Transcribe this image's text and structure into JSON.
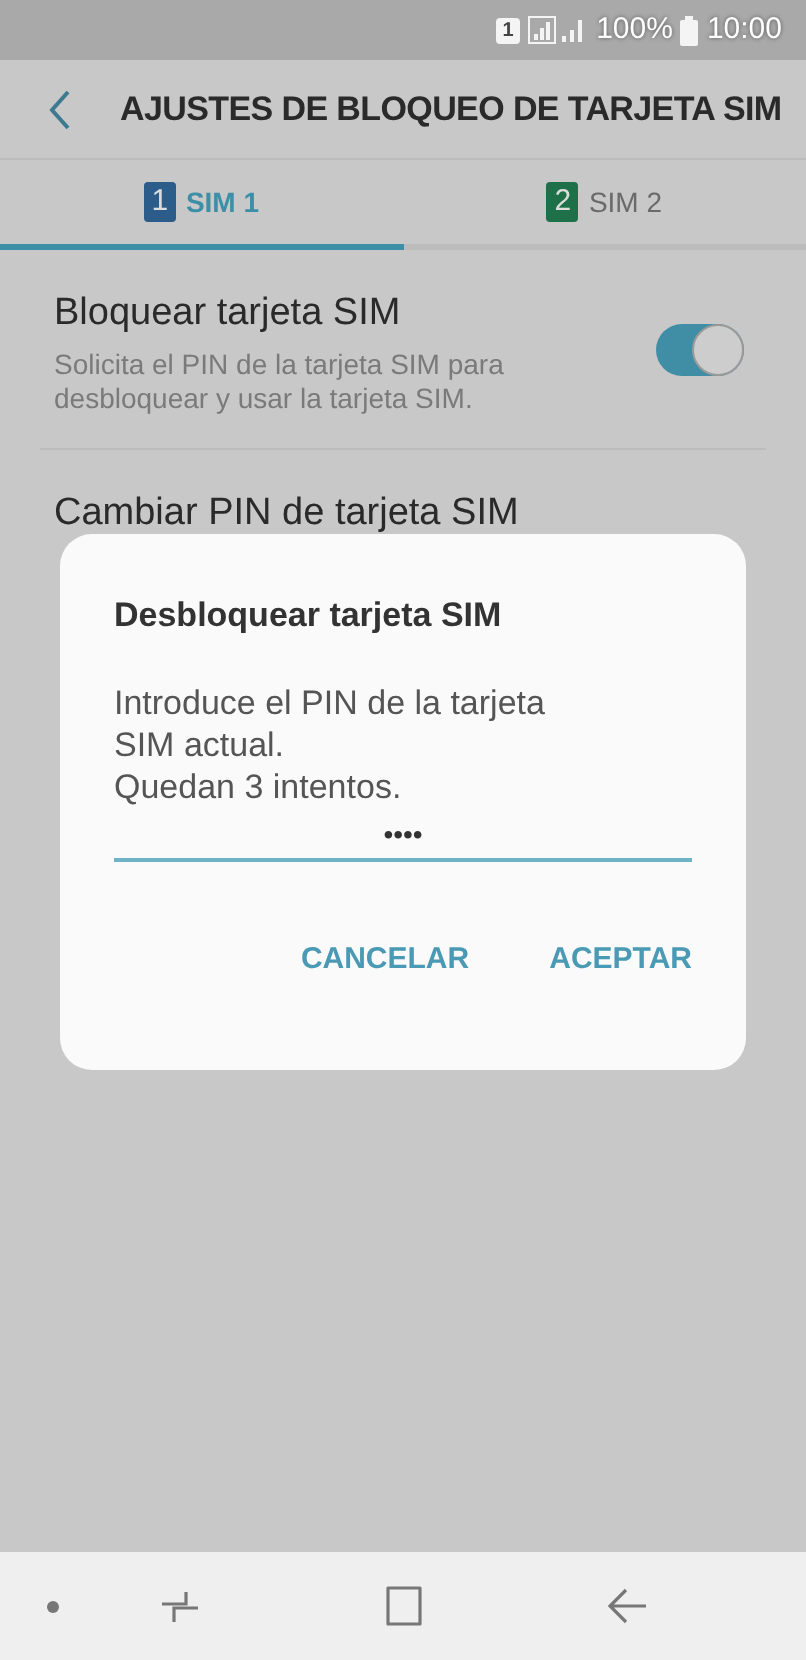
{
  "status_bar": {
    "sim_badge": "1",
    "battery": "100%",
    "time": "10:00"
  },
  "header": {
    "title": "AJUSTES DE BLOQUEO DE TARJETA SIM"
  },
  "tabs": [
    {
      "badge": "1",
      "color": "#2b5c8a",
      "label": "SIM 1",
      "selected": true
    },
    {
      "badge": "2",
      "color": "#1e7048",
      "label": "SIM 2",
      "selected": false
    }
  ],
  "settings": [
    {
      "kind": "switch",
      "title": "Bloquear tarjeta SIM",
      "summary": "Solicita el PIN de la tarjeta SIM para desbloquear y usar la tarjeta SIM.",
      "on": true
    },
    {
      "kind": "plain",
      "title": "Cambiar PIN de tarjeta SIM"
    }
  ],
  "dialog": {
    "title": "Desbloquear tarjeta SIM",
    "message_lines": [
      "Introduce el PIN de la tarjeta",
      "SIM actual.",
      "Quedan 3 intentos."
    ],
    "pin_value": "••••",
    "buttons": [
      "CANCELAR",
      "ACEPTAR"
    ]
  }
}
